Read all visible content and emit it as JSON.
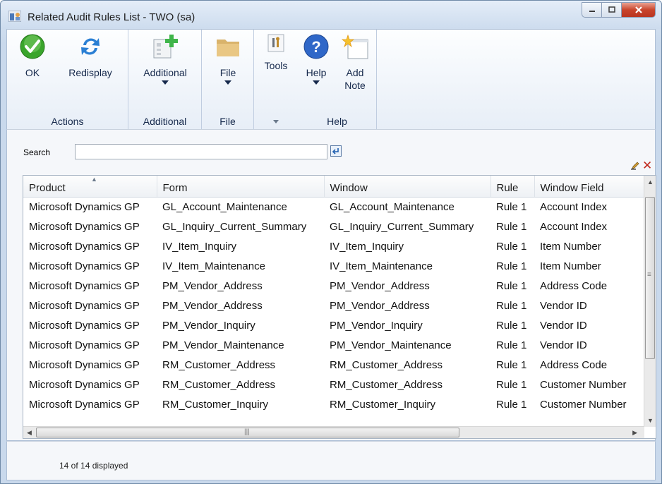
{
  "window": {
    "title": "Related Audit Rules List  -  TWO (sa)"
  },
  "ribbon": {
    "ok_label": "OK",
    "redisplay_label": "Redisplay",
    "actions_group": "Actions",
    "additional_label": "Additional",
    "additional_group": "Additional",
    "file_label": "File",
    "file_group": "File",
    "tools_label": "Tools",
    "help_label": "Help",
    "add_note_label": "Add Note",
    "help_group": "Help"
  },
  "search": {
    "label": "Search",
    "value": ""
  },
  "grid": {
    "columns": [
      "Product",
      "Form",
      "Window",
      "Rule",
      "Window Field"
    ],
    "rows": [
      [
        "Microsoft Dynamics GP",
        "GL_Account_Maintenance",
        "GL_Account_Maintenance",
        "Rule 1",
        "Account Index"
      ],
      [
        "Microsoft Dynamics GP",
        "GL_Inquiry_Current_Summary",
        "GL_Inquiry_Current_Summary",
        "Rule 1",
        "Account Index"
      ],
      [
        "Microsoft Dynamics GP",
        "IV_Item_Inquiry",
        "IV_Item_Inquiry",
        "Rule 1",
        "Item Number"
      ],
      [
        "Microsoft Dynamics GP",
        "IV_Item_Maintenance",
        "IV_Item_Maintenance",
        "Rule 1",
        "Item Number"
      ],
      [
        "Microsoft Dynamics GP",
        "PM_Vendor_Address",
        "PM_Vendor_Address",
        "Rule 1",
        "Address Code"
      ],
      [
        "Microsoft Dynamics GP",
        "PM_Vendor_Address",
        "PM_Vendor_Address",
        "Rule 1",
        "Vendor ID"
      ],
      [
        "Microsoft Dynamics GP",
        "PM_Vendor_Inquiry",
        "PM_Vendor_Inquiry",
        "Rule 1",
        "Vendor ID"
      ],
      [
        "Microsoft Dynamics GP",
        "PM_Vendor_Maintenance",
        "PM_Vendor_Maintenance",
        "Rule 1",
        "Vendor ID"
      ],
      [
        "Microsoft Dynamics GP",
        "RM_Customer_Address",
        "RM_Customer_Address",
        "Rule 1",
        "Address Code"
      ],
      [
        "Microsoft Dynamics GP",
        "RM_Customer_Address",
        "RM_Customer_Address",
        "Rule 1",
        "Customer Number"
      ],
      [
        "Microsoft Dynamics GP",
        "RM_Customer_Inquiry",
        "RM_Customer_Inquiry",
        "Rule 1",
        "Customer Number"
      ]
    ]
  },
  "status": {
    "count_text": "14 of 14 displayed"
  },
  "colors": {
    "accent": "#1f5fb0",
    "ok_green": "#3aa52c",
    "close_red": "#c9452c"
  }
}
